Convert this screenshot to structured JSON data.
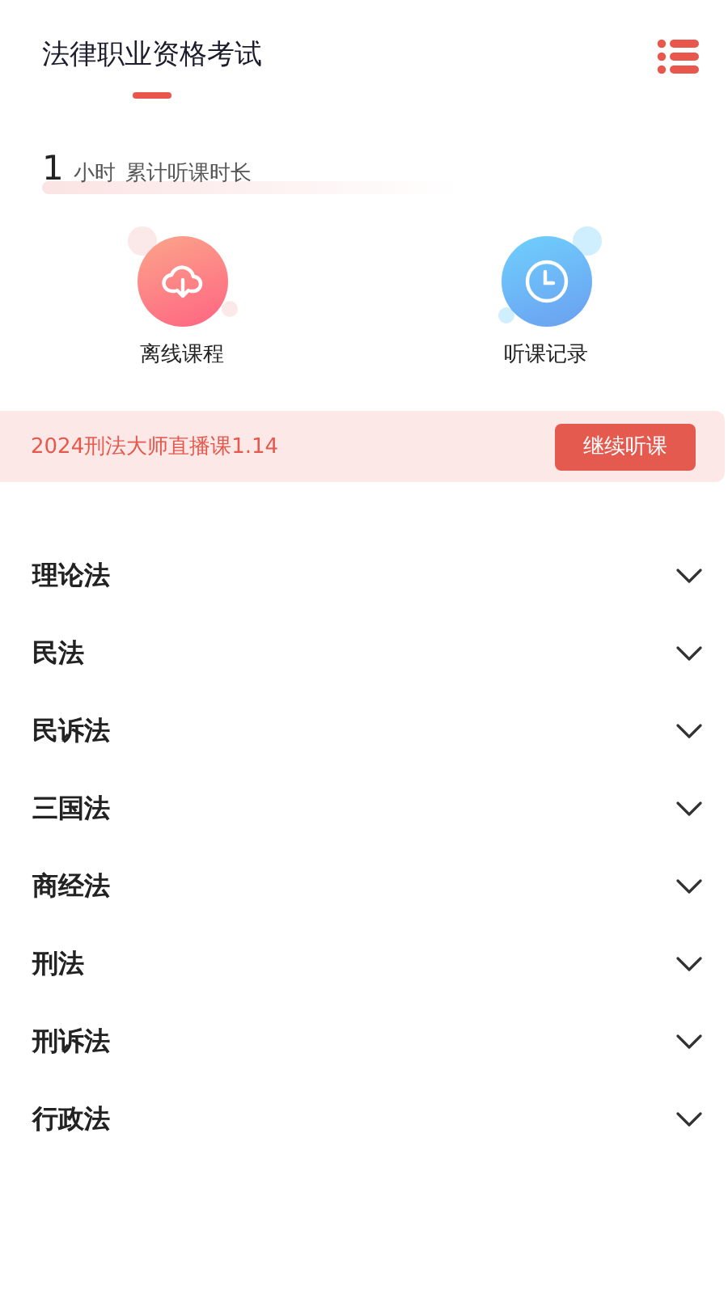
{
  "header": {
    "tabs": [
      {
        "label": "法律职业资格考试",
        "selected": true
      }
    ]
  },
  "study_time": {
    "value": "1",
    "unit": "小时",
    "label": "累计听课时长"
  },
  "shortcuts": [
    {
      "kind": "download",
      "label": "离线课程"
    },
    {
      "kind": "history",
      "label": "听课记录"
    }
  ],
  "resume": {
    "title": "2024刑法大师直播课1.14",
    "button": "继续听课"
  },
  "subjects": [
    {
      "label": "理论法",
      "expanded": false
    },
    {
      "label": "民法",
      "expanded": false
    },
    {
      "label": "民诉法",
      "expanded": false
    },
    {
      "label": "三国法",
      "expanded": false
    },
    {
      "label": "商经法",
      "expanded": false
    },
    {
      "label": "刑法",
      "expanded": false
    },
    {
      "label": "刑诉法",
      "expanded": false
    },
    {
      "label": "行政法",
      "expanded": false
    }
  ]
}
